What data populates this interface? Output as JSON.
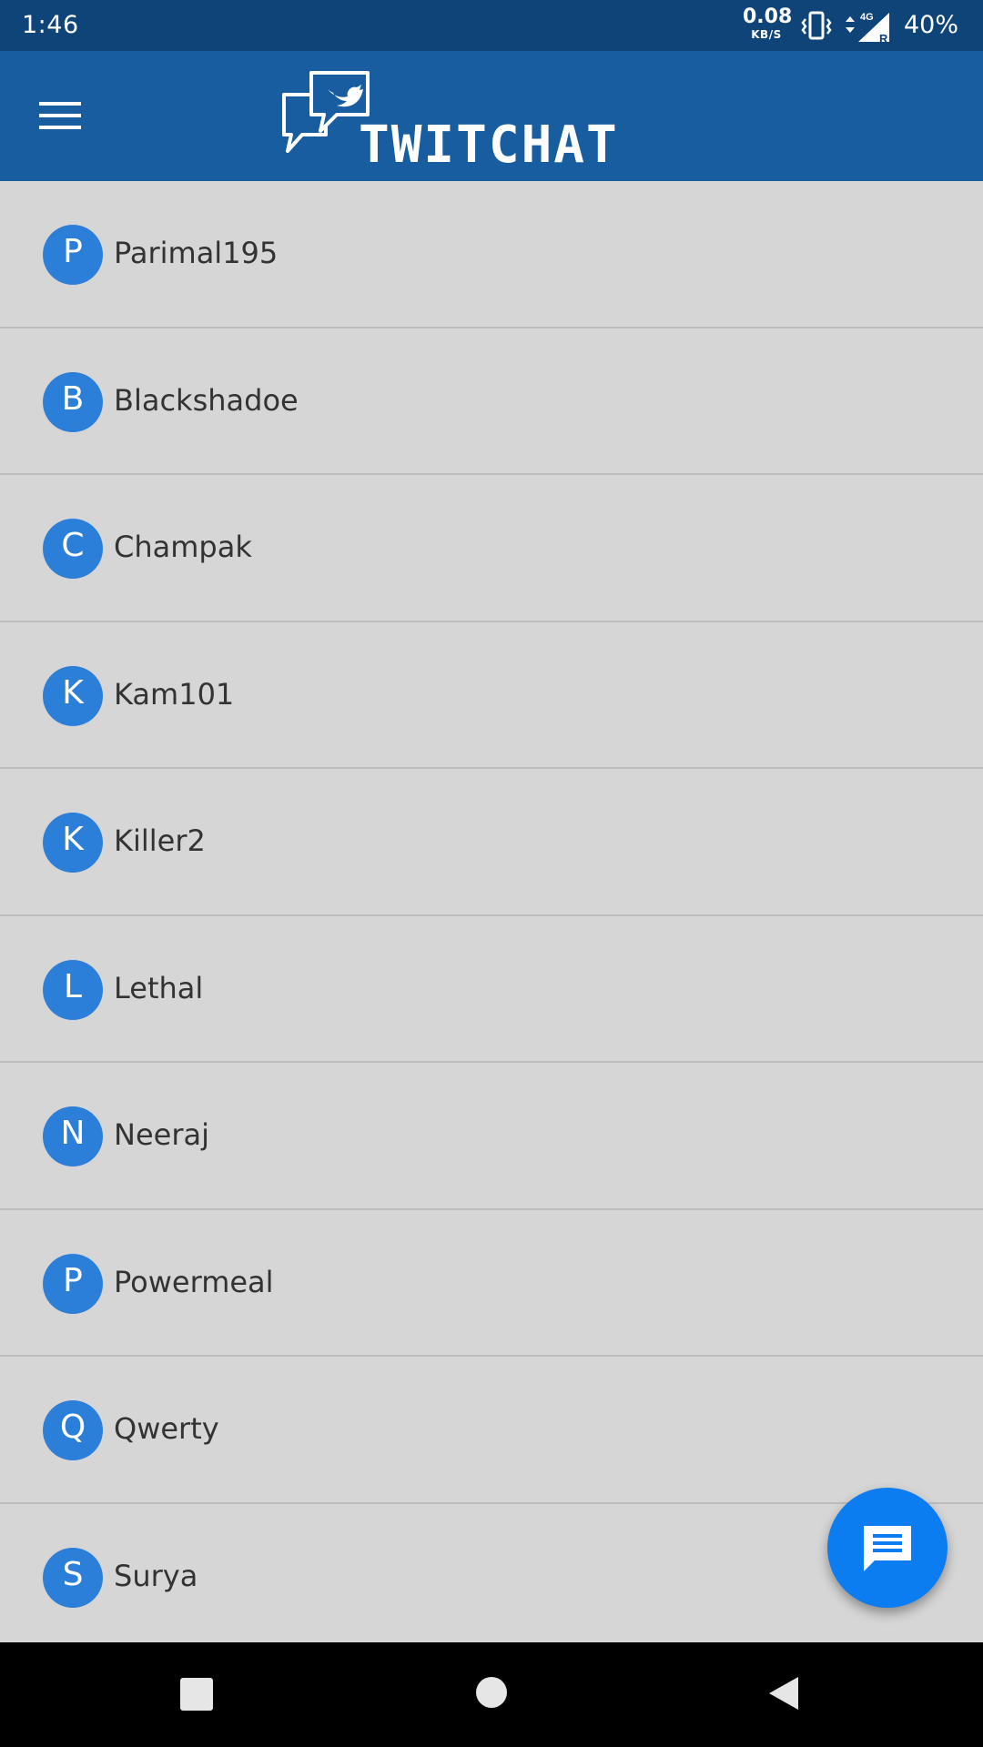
{
  "status_bar": {
    "time": "1:46",
    "net_speed_value": "0.08",
    "net_speed_unit": "KB/S",
    "network_type": "4G",
    "roaming": "R",
    "battery": "40%",
    "icons": [
      "vibrate-icon",
      "signal-icon"
    ]
  },
  "app_bar": {
    "logo_text": "TWITCHAT",
    "menu_icon": "hamburger-menu-icon",
    "color": "#175d9f"
  },
  "users": [
    {
      "initial": "P",
      "name": "Parimal195"
    },
    {
      "initial": "B",
      "name": "Blackshadoe"
    },
    {
      "initial": "C",
      "name": "Champak"
    },
    {
      "initial": "K",
      "name": "Kam101"
    },
    {
      "initial": "K",
      "name": "Killer2"
    },
    {
      "initial": "L",
      "name": "Lethal"
    },
    {
      "initial": "N",
      "name": "Neeraj"
    },
    {
      "initial": "P",
      "name": "Powermeal"
    },
    {
      "initial": "Q",
      "name": "Qwerty"
    },
    {
      "initial": "S",
      "name": "Surya"
    }
  ],
  "avatar_color": "#2c7fd8",
  "fab": {
    "icon": "chat-message-icon",
    "color": "#0b7df0"
  },
  "nav_bar": {
    "icons": [
      "recents-square-icon",
      "home-circle-icon",
      "back-triangle-icon"
    ]
  }
}
